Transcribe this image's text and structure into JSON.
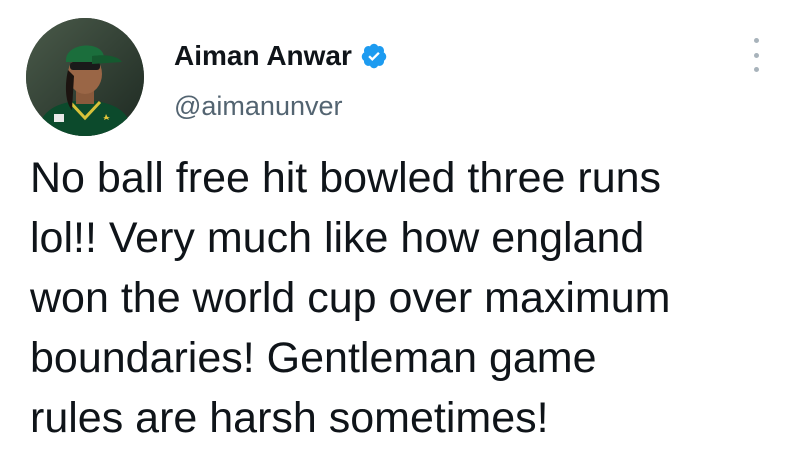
{
  "author": {
    "name": "Aiman Anwar",
    "handle": "@aimanunver",
    "verified": true
  },
  "menu": {
    "icon": "more-options-vertical-icon"
  },
  "tweet": {
    "lines": [
      "No ball free hit bowled three runs",
      "lol!! Very much like how england",
      "won the world cup over maximum",
      "boundaries! Gentleman game",
      "rules are harsh sometimes!"
    ]
  },
  "colors": {
    "text": "#0f1419",
    "handle": "#536471",
    "verified_badge": "#1d9bf0",
    "menu_dots": "#a8b3bb"
  }
}
